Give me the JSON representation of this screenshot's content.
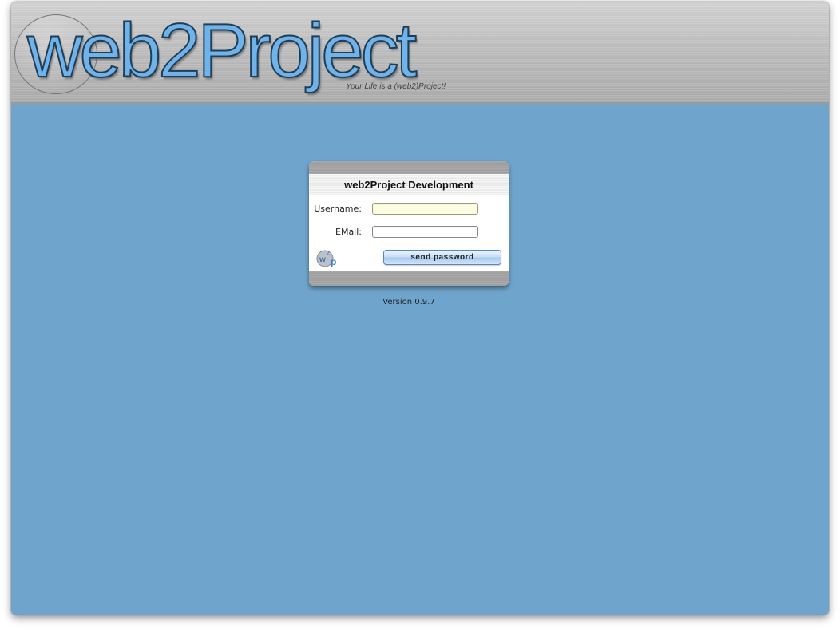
{
  "header": {
    "logo_text": "web2Project",
    "tagline": "Your Life is a (web2)Project!"
  },
  "login": {
    "title": "web2Project Development",
    "username_label": "Username:",
    "username_value": "",
    "email_label": "EMail:",
    "email_value": "",
    "submit_label": "send password",
    "icon": "w2p-logo-icon"
  },
  "footer": {
    "version": "Version 0.9.7"
  },
  "colors": {
    "background": "#6fa5cc",
    "logo": "#6fb3ea",
    "username_field_bg": "#fdfde0"
  }
}
